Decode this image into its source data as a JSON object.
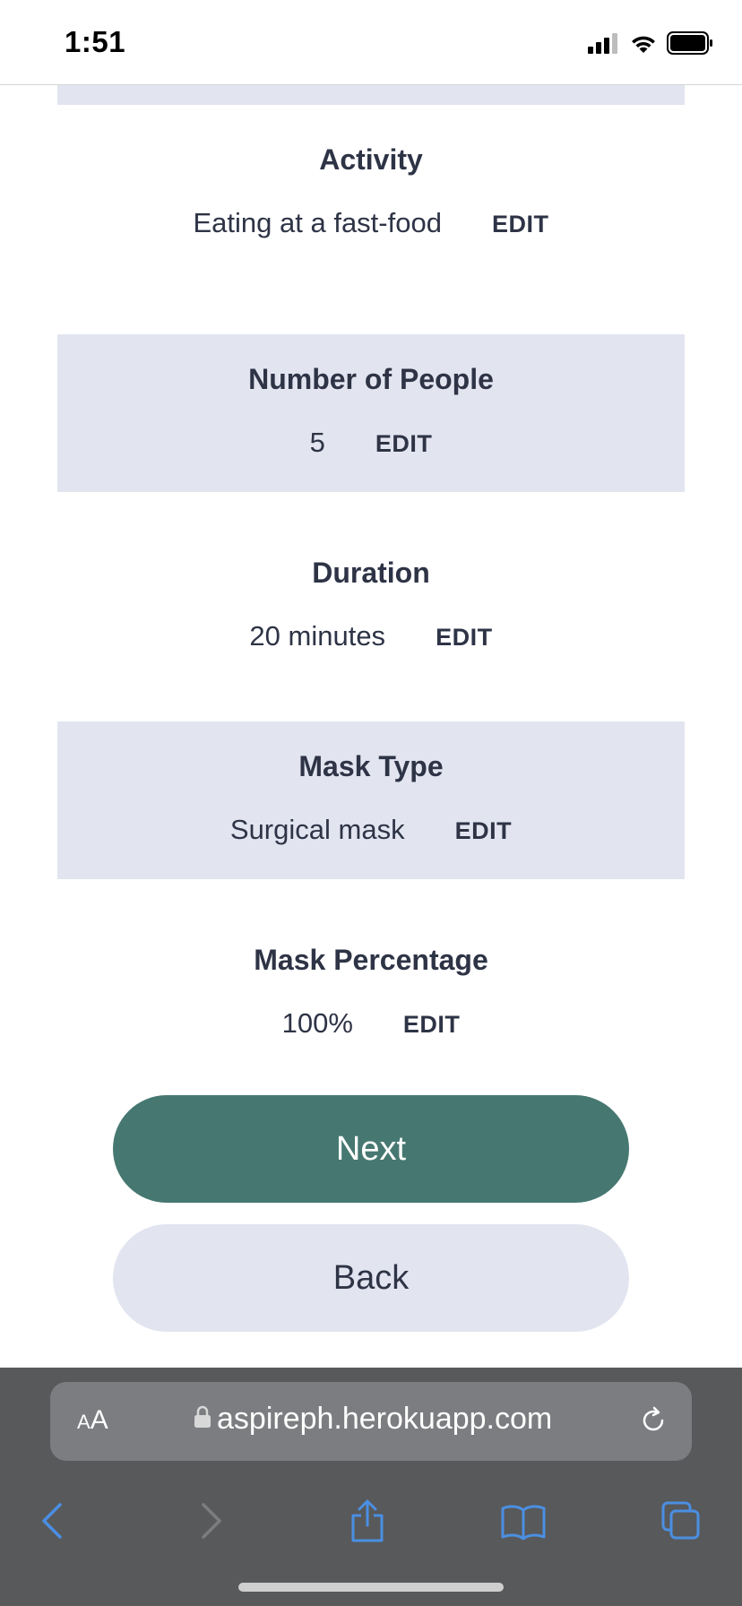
{
  "status_bar": {
    "time": "1:51"
  },
  "sections": [
    {
      "title": "Activity",
      "value": "Eating at a fast-food",
      "edit_label": "EDIT"
    },
    {
      "title": "Number of People",
      "value": "5",
      "edit_label": "EDIT"
    },
    {
      "title": "Duration",
      "value": "20 minutes",
      "edit_label": "EDIT"
    },
    {
      "title": "Mask Type",
      "value": "Surgical mask",
      "edit_label": "EDIT"
    },
    {
      "title": "Mask Percentage",
      "value": "100%",
      "edit_label": "EDIT"
    }
  ],
  "buttons": {
    "next_label": "Next",
    "back_label": "Back"
  },
  "browser": {
    "aa_small": "A",
    "aa_large": "A",
    "url": "aspireph.herokuapp.com"
  },
  "colors": {
    "accent": "#467871",
    "panel": "#e2e5f0",
    "text": "#2e3446",
    "browser_link": "#4a8fe2"
  }
}
